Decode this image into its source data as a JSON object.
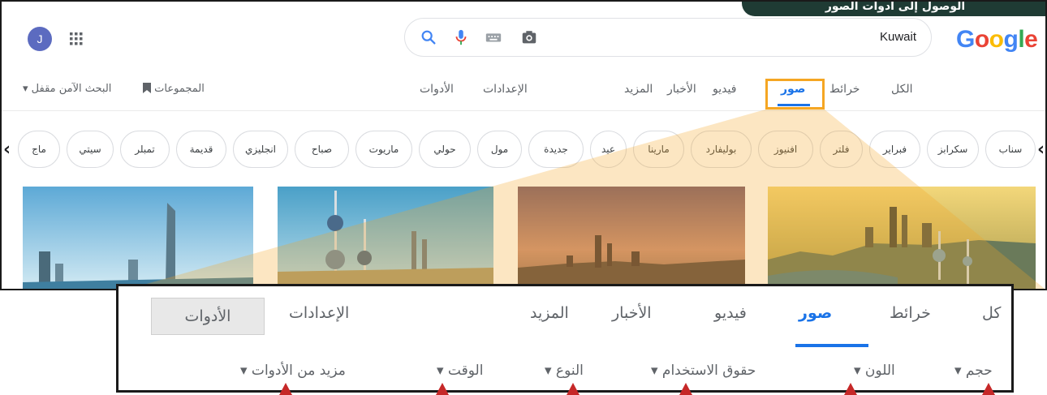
{
  "banner": {
    "text": "الوصول إلى أدوات الصور"
  },
  "logo": {
    "letters": [
      "G",
      "o",
      "o",
      "g",
      "l",
      "e"
    ],
    "colors": [
      "#4285F4",
      "#EA4335",
      "#FBBC05",
      "#4285F4",
      "#34A853",
      "#EA4335"
    ]
  },
  "search": {
    "query": "Kuwait",
    "icons": [
      "search-icon",
      "microphone-icon",
      "keyboard-icon",
      "camera-icon"
    ]
  },
  "account": {
    "avatar_letter": "J",
    "apps_icon": "apps-grid-icon"
  },
  "nav": {
    "tabs": [
      "الكل",
      "خرائط",
      "صور",
      "فيديو",
      "الأخبار",
      "المزيد",
      "الإعدادات",
      "الأدوات"
    ],
    "active": "صور",
    "collections": "المجموعات",
    "safesearch": "البحث الآمن مقفل ▾"
  },
  "chips": [
    "سناب",
    "سكرابز",
    "فبراير",
    "فلتر",
    "افنيوز",
    "بوليفارد",
    "مارينا",
    "عيد",
    "جديدة",
    "مول",
    "حولي",
    "ماريوت",
    "صباح",
    "انجليزي",
    "قديمة",
    "تمبلر",
    "سيتي",
    "ماج"
  ],
  "zoom": {
    "tabs": [
      "كل",
      "خرائط",
      "صور",
      "فيديو",
      "الأخبار",
      "المزيد",
      "الإعدادات",
      "الأدوات"
    ],
    "filters": [
      "حجم ▾",
      "اللون ▾",
      "حقوق الاستخدام ▾",
      "النوع ▾",
      "الوقت ▾",
      "مزيد من الأدوات ▾"
    ]
  },
  "colors": {
    "accent": "#1a73e8",
    "highlight": "#f5a623",
    "marker": "#c62828"
  }
}
